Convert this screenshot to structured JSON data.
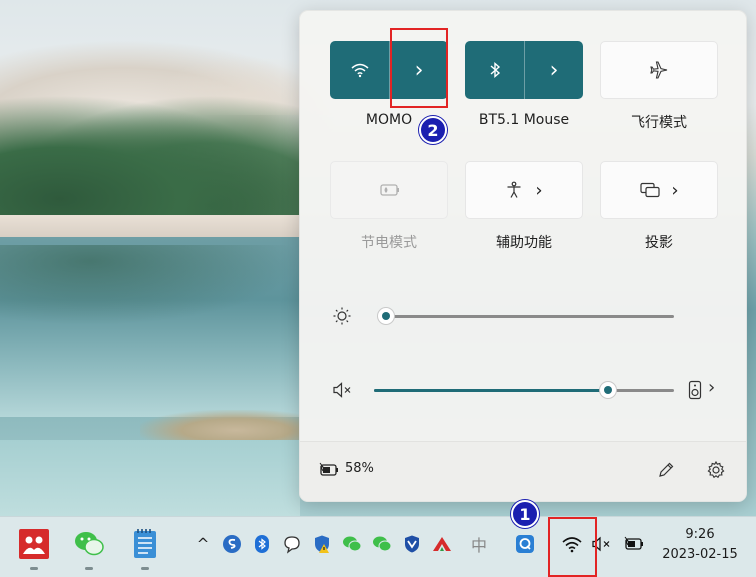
{
  "quick_settings": {
    "wifi": {
      "network": "MOMO",
      "expanded_chevron": "›"
    },
    "bluetooth": {
      "device": "BT5.1 Mouse",
      "expanded_chevron": "›"
    },
    "airplane": {
      "label": "飞行模式"
    },
    "battery_saver": {
      "label": "节电模式"
    },
    "accessibility": {
      "label": "辅助功能",
      "chevron": "›"
    },
    "project": {
      "label": "投影",
      "chevron": "›"
    },
    "brightness": {
      "level": 0.0
    },
    "volume": {
      "level": 0.8,
      "muted": true,
      "output_chevron": "›"
    },
    "footer": {
      "battery_percent": "58%"
    }
  },
  "annotations": {
    "step1": "1",
    "step2": "2"
  },
  "taskbar": {
    "overflow_chevron": "^",
    "ime": "中",
    "time": "9:26",
    "date": "2023-02-15"
  },
  "colors": {
    "accent": "#1f6c77",
    "badge": "#1b1fb0",
    "highlight": "#e22424"
  }
}
